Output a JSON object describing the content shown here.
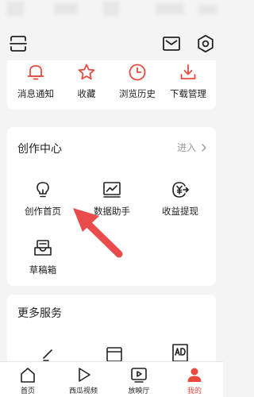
{
  "quick_items": [
    {
      "label": "消息通知",
      "icon": "bell-icon"
    },
    {
      "label": "收藏",
      "icon": "star-icon"
    },
    {
      "label": "浏览历史",
      "icon": "clock-icon"
    },
    {
      "label": "下载管理",
      "icon": "download-icon"
    }
  ],
  "creator": {
    "title": "创作中心",
    "enter_label": "进入",
    "items": [
      {
        "label": "创作首页",
        "icon": "lightbulb-icon"
      },
      {
        "label": "数据助手",
        "icon": "chart-monitor-icon"
      },
      {
        "label": "收益提现",
        "icon": "yuan-withdraw-icon"
      },
      {
        "label": "草稿箱",
        "icon": "drafts-inbox-icon"
      }
    ]
  },
  "more_services": {
    "title": "更多服务"
  },
  "tabs": [
    {
      "label": "首页",
      "icon": "home-icon"
    },
    {
      "label": "西瓜视频",
      "icon": "play-triangle-icon"
    },
    {
      "label": "放映厅",
      "icon": "tv-play-icon"
    },
    {
      "label": "我的",
      "icon": "profile-icon",
      "active": true
    }
  ],
  "colors": {
    "accent": "#e94a3f",
    "arrow": "#ea4b4b"
  }
}
